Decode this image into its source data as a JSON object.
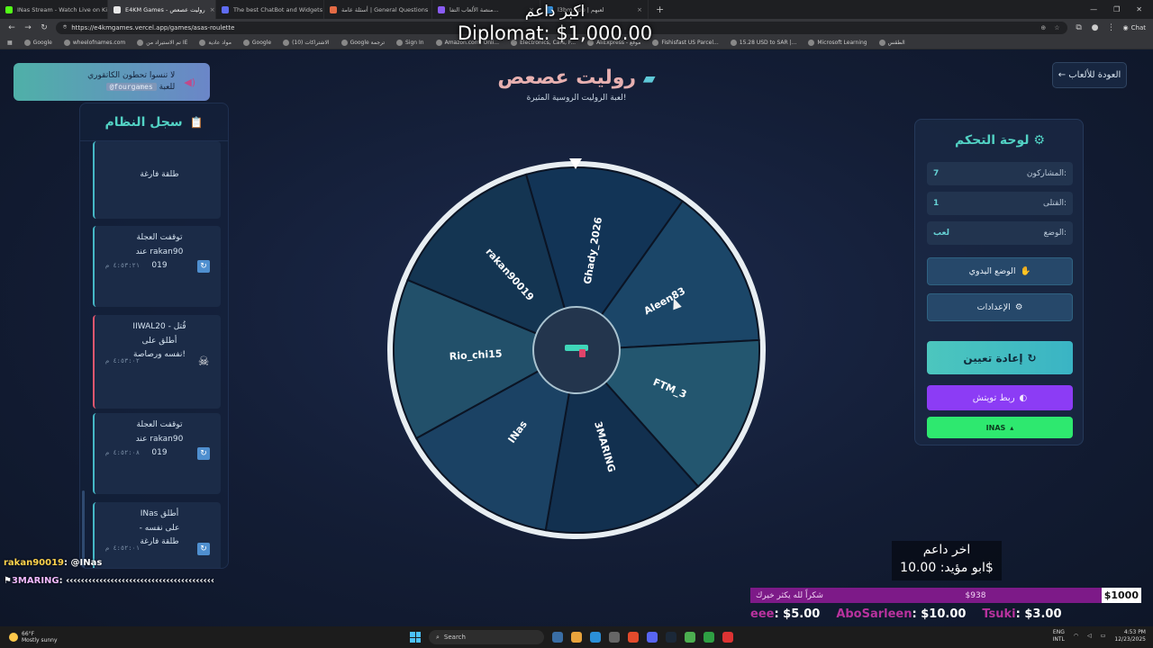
{
  "browser": {
    "tabs": [
      {
        "title": "INas Stream - Watch Live on Kick",
        "color": "#53fc18",
        "active": false
      },
      {
        "title": "E4KM Games - روليت عصعص",
        "color": "#e8e8e8",
        "active": true
      },
      {
        "title": "The best ChatBot and Widgets for",
        "color": "#5f6cf2",
        "active": false
      },
      {
        "title": "أسئلة عامة | General Questions",
        "color": "#e46b45",
        "active": false
      },
      {
        "title": "منصة الألعاب التفا...",
        "color": "#8a5cf5",
        "active": false
      },
      {
        "title": "l3bm.app | لعبهم",
        "color": "#3aa0f5",
        "active": false
      }
    ],
    "url": "https://e4kmgames.vercel.app/games/asas-roulette",
    "chat_label": "Chat",
    "bookmarks": [
      "Google",
      "wheelofnames.com",
      "تم الاستيراد من IE",
      "مواد عادية",
      "Google",
      "(10) الاشتراكات",
      "Google ترجمة",
      "Sign In",
      "Amazon.com: Onli...",
      "Electronics, Cars, F...",
      "AliExpress - موقع",
      "Fishisfast US Parcel...",
      "15.28 USD to SAR |...",
      "Microsoft Learning",
      "الطقس"
    ]
  },
  "toast": {
    "line1": "لا تنسوا تحطون الكاتقوري",
    "line2_prefix": "للعبة",
    "code": "@fourgames"
  },
  "log": {
    "title": "سجل النظام",
    "entries": [
      {
        "text": "طلقة فارغة",
        "time": "",
        "icon": "reload-icon",
        "type": "normal"
      },
      {
        "text": "توقفت العجلة عند rakan90 019",
        "time": "٤:٥٣:٢١ م",
        "icon": "reload-icon",
        "type": "normal"
      },
      {
        "text": "IIWAL20 قُتل - أطلق على نفسه ورصاصة!",
        "time": "٤:٥٣:٠٢ م",
        "icon": "skull-icon",
        "type": "kill"
      },
      {
        "text": "توقفت العجلة عند rakan90 019",
        "time": "٤:٥٢:٠٨ م",
        "icon": "reload-icon",
        "type": "normal"
      },
      {
        "text": "INas أطلق على نفسه - طلقة فارغة",
        "time": "٤:٥٢:٠١ م",
        "icon": "reload-icon",
        "type": "normal"
      }
    ]
  },
  "header": {
    "title": "روليت عصعص",
    "subtitle": "لعبة الروليت الروسية المثيرة!",
    "back_label": "← العودة للألعاب"
  },
  "wheel": {
    "segments": [
      {
        "name": "Ghady_2026",
        "color": "#123456"
      },
      {
        "name": "Aleen83",
        "color": "#1b4668"
      },
      {
        "name": "FTM_3",
        "color": "#23566f"
      },
      {
        "name": "3MARING",
        "color": "#12304f"
      },
      {
        "name": "INas",
        "color": "#1b4264"
      },
      {
        "name": "Rio_chi15",
        "color": "#22506a"
      },
      {
        "name": "rakan90019",
        "color": "#143552"
      }
    ],
    "rotation_deg": 344,
    "rim_color": "#e8eef2"
  },
  "control": {
    "title": "لوحة التحكم",
    "participants_label": "المشاركون:",
    "participants": "7",
    "killed_label": "القتلى:",
    "killed": "1",
    "mode_label": "الوضع:",
    "mode": "لعب",
    "manual_label": "الوضع اليدوي",
    "settings_label": "الإعدادات",
    "reset_label": "إعادة تعيين",
    "twitch_label": "ربط تويتش",
    "inas_label": "INAS"
  },
  "overlay": {
    "top_line1": "اكبر داعم",
    "top_line2": "Diplomat: $1,000.00",
    "chat": [
      {
        "user": "rakan90019",
        "msg": ": @INas"
      },
      {
        "user": "3MARING",
        "msg": ": ‹‹‹‹‹‹‹‹‹‹‹‹‹‹‹‹‹‹‹‹‹‹‹‹‹‹‹‹‹‹‹‹‹‹‹‹‹‹‹‹"
      }
    ],
    "donor_line1": "اخر داعم",
    "donor_line2": "ابو مؤيد: 10.00$",
    "goal_left": "شكراً لله يكثر خيرك",
    "goal_mid": "$938",
    "goal_right": "$1000",
    "ticker": [
      {
        "name": "eee",
        "amount": ": $5.00"
      },
      {
        "name": "AboSarleen",
        "amount": ": $10.00"
      },
      {
        "name": "Tsuki",
        "amount": ": $3.00"
      }
    ]
  },
  "taskbar": {
    "temp": "66°F",
    "weather": "Mostly sunny",
    "search": "Search",
    "lang1": "ENG",
    "lang2": "INTL",
    "time": "4:53 PM",
    "date": "12/23/2025"
  }
}
